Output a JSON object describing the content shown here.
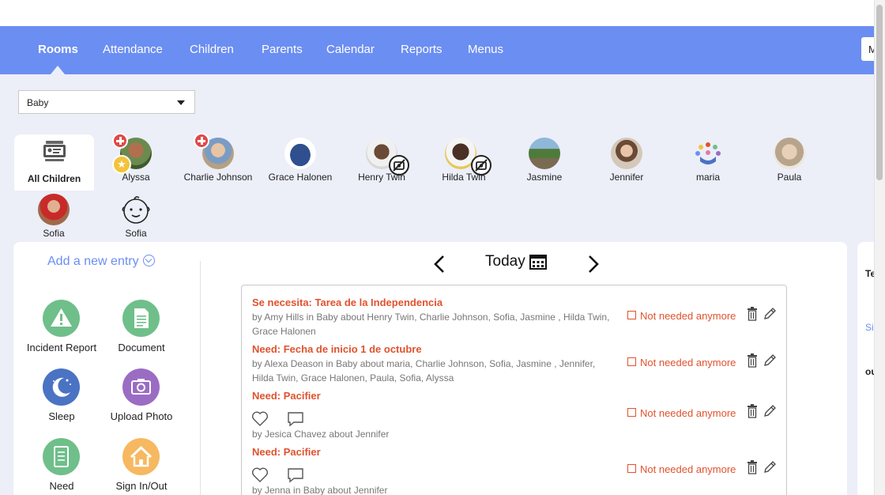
{
  "nav": {
    "items": [
      "Rooms",
      "Attendance",
      "Children",
      "Parents",
      "Calendar",
      "Reports",
      "Menus"
    ],
    "active": "Rooms",
    "menu_button_label": "M"
  },
  "room_select": {
    "value": "Baby"
  },
  "children_filter": {
    "all_label": "All Children",
    "children": [
      {
        "name": "Alyssa",
        "badges": [
          "medical",
          "star"
        ]
      },
      {
        "name": "Charlie Johnson",
        "badges": [
          "medical"
        ]
      },
      {
        "name": "Grace Halonen",
        "badges": []
      },
      {
        "name": "Henry Twin",
        "badges": [
          "no-photo"
        ]
      },
      {
        "name": "Hilda Twin",
        "badges": [
          "no-photo"
        ]
      },
      {
        "name": "Jasmine",
        "badges": []
      },
      {
        "name": "Jennifer",
        "badges": []
      },
      {
        "name": "maria",
        "badges": []
      },
      {
        "name": "Paula",
        "badges": []
      },
      {
        "name": "Sofia",
        "badges": []
      },
      {
        "name": "Sofia",
        "badges": []
      }
    ]
  },
  "add_entry": {
    "label": "Add a new entry",
    "actions": [
      {
        "label": "Incident Report",
        "color": "#6fbf8a",
        "icon": "warning-icon"
      },
      {
        "label": "Document",
        "color": "#6fbf8a",
        "icon": "document-icon"
      },
      {
        "label": "Sleep",
        "color": "#4a73c4",
        "icon": "moon-icon"
      },
      {
        "label": "Upload Photo",
        "color": "#9b6cc4",
        "icon": "camera-icon"
      },
      {
        "label": "Need",
        "color": "#6fbf8a",
        "icon": "checklist-icon"
      },
      {
        "label": "Sign In/Out",
        "color": "#f6b860",
        "icon": "home-icon"
      }
    ]
  },
  "date_nav": {
    "label": "Today"
  },
  "entries": [
    {
      "title": "Se necesita: Tarea de la Independencia",
      "meta": "by Amy Hills in Baby about Henry Twin, Charlie Johnson, Sofia, Jasmine , Hilda Twin, Grace Halonen",
      "action": "Not needed anymore"
    },
    {
      "title": "Need: Fecha de inicio 1 de octubre",
      "meta": "by Alexa Deason in Baby about maria, Charlie Johnson, Sofia, Jasmine , Jennifer, Hilda Twin, Grace Halonen, Paula, Sofia, Alyssa",
      "action": "Not needed anymore"
    },
    {
      "title": "Need: Pacifier",
      "meta": "by Jesica Chavez about Jennifer",
      "action": "Not needed anymore"
    },
    {
      "title": "Need: Pacifier",
      "meta": "by Jenna in Baby about Jennifer",
      "action": "Not needed anymore"
    }
  ],
  "right_panel": {
    "line1": "Te",
    "line2": "Si",
    "line3": "ou"
  },
  "colors": {
    "nav": "#6b8ef2",
    "accent": "#6b8ef2",
    "need": "#e0522e",
    "background": "#eceef8"
  }
}
